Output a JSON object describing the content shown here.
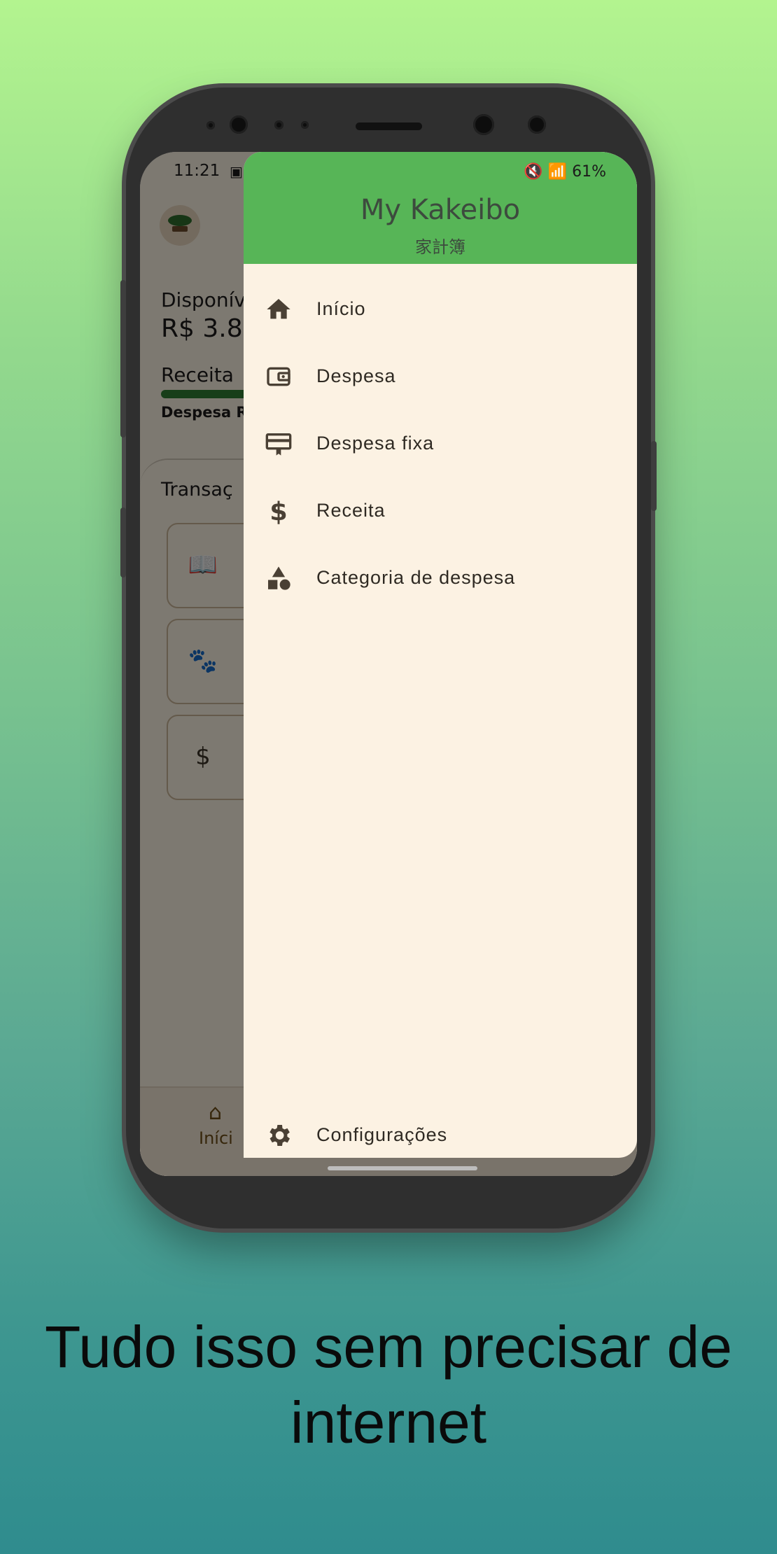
{
  "status_bar": {
    "time": "11:21",
    "battery": "61%"
  },
  "home": {
    "available_label": "Disponív",
    "amount": "R$  3.8",
    "receita_label": "Receita",
    "despesa_label": "Despesa R",
    "transactions_title": "Transaç",
    "nav_home_label": "Iníci"
  },
  "drawer": {
    "title": "My Kakeibo",
    "subtitle": "家計簿",
    "items": [
      {
        "label": "Início",
        "icon": "home-icon"
      },
      {
        "label": "Despesa",
        "icon": "wallet-icon"
      },
      {
        "label": "Despesa fixa",
        "icon": "card-icon"
      },
      {
        "label": "Receita",
        "icon": "dollar-icon"
      },
      {
        "label": "Categoria de despesa",
        "icon": "category-icon"
      }
    ],
    "settings_label": "Configurações"
  },
  "colors": {
    "drawer_header": "#57b557",
    "drawer_bg": "#fcf2e3",
    "accent_brown": "#6d4c16"
  },
  "tagline": "Tudo isso sem precisar de internet"
}
